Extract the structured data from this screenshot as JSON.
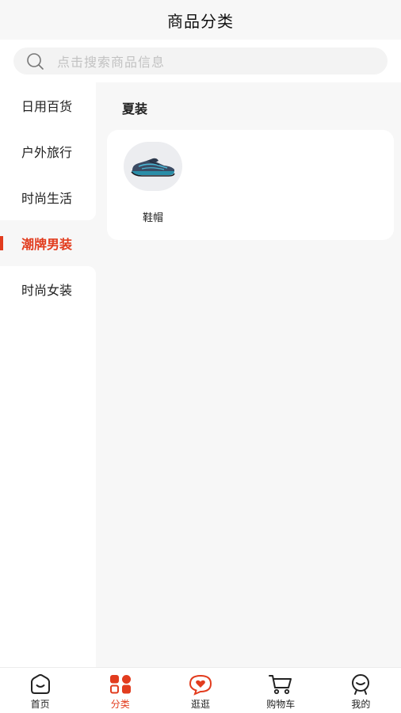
{
  "header": {
    "title": "商品分类"
  },
  "search": {
    "placeholder": "点击搜索商品信息",
    "icon": "search-icon"
  },
  "sidebar": {
    "items": [
      {
        "label": "日用百货",
        "active": false
      },
      {
        "label": "户外旅行",
        "active": false
      },
      {
        "label": "时尚生活",
        "active": false
      },
      {
        "label": "潮牌男装",
        "active": true
      },
      {
        "label": "时尚女装",
        "active": false
      }
    ]
  },
  "main": {
    "section_title": "夏装",
    "categories": [
      {
        "label": "鞋帽",
        "icon": "sneaker-image"
      }
    ]
  },
  "tabbar": {
    "items": [
      {
        "label": "首页",
        "icon": "home-icon",
        "active": false
      },
      {
        "label": "分类",
        "icon": "category-icon",
        "active": true
      },
      {
        "label": "逛逛",
        "icon": "heart-chat-icon",
        "active": false
      },
      {
        "label": "购物车",
        "icon": "cart-icon",
        "active": false
      },
      {
        "label": "我的",
        "icon": "profile-icon",
        "active": false
      }
    ]
  },
  "colors": {
    "accent": "#e23c1e",
    "background": "#f7f7f7",
    "card": "#ffffff"
  }
}
